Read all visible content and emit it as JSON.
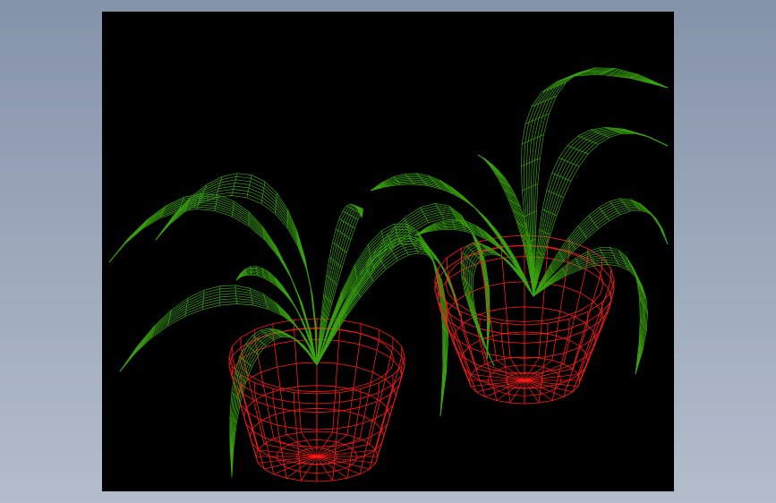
{
  "scene": {
    "viewport_background": "#000000",
    "page_background": "#8d9ab0",
    "render_style": "wireframe",
    "objects": [
      {
        "name": "plant-left",
        "leaf_color": "#3aa310",
        "pot_color": "#ff1a1a"
      },
      {
        "name": "plant-right",
        "leaf_color": "#3aa310",
        "pot_color": "#ff1a1a"
      }
    ]
  }
}
